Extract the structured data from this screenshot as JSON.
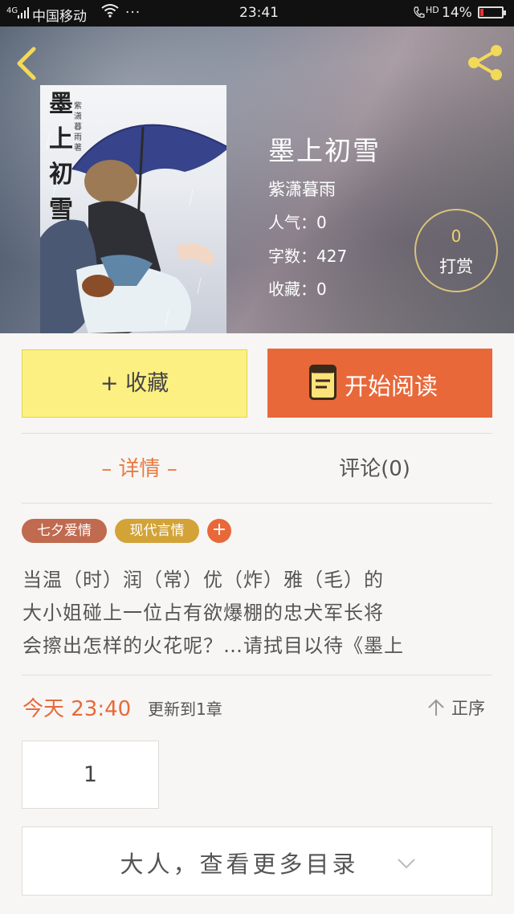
{
  "status_bar": {
    "network": "4G",
    "carrier": "中国移动",
    "dots": "···",
    "time": "23:41",
    "hd": "HD",
    "battery": "14%",
    "battery_level": 0.14
  },
  "book": {
    "cover_title": "墨上初雪",
    "cover_author": "紫潇暮雨著",
    "title": "墨上初雪",
    "author": "紫潇暮雨",
    "popularity": "人气：0",
    "word_count": "字数：427",
    "favorites": "收藏：0"
  },
  "reward": {
    "count": "0",
    "label": "打赏"
  },
  "actions": {
    "collect_label": "+ 收藏",
    "read_label": "开始阅读"
  },
  "tabs": {
    "detail": "– 详情 –",
    "comments": "评论(0)"
  },
  "tags": [
    "七夕爱情",
    "现代言情"
  ],
  "tag_add": "+",
  "synopsis": "当温（时）润（常）优（炸）雅（毛）的\n大小姐碰上一位占有欲爆棚的忠犬军长将\n会擦出怎样的火花呢？…请拭目以待《墨上",
  "update": {
    "today": "今天 23:40",
    "chapter": "更新到1章"
  },
  "sort_label": "正序",
  "chapters": [
    "1"
  ],
  "more_catalog": "大人，查看更多目录",
  "colors": {
    "accent_orange": "#e8683a",
    "collect_yellow": "#fcf082",
    "tag_brown": "#c06a4f",
    "tag_gold": "#d3a338",
    "reward_gold": "#d9c37a"
  },
  "icons": {
    "back": "chevron-left-icon",
    "share": "share-icon",
    "read": "book-icon",
    "sort": "arrow-up-icon",
    "more": "chevron-down-icon"
  }
}
